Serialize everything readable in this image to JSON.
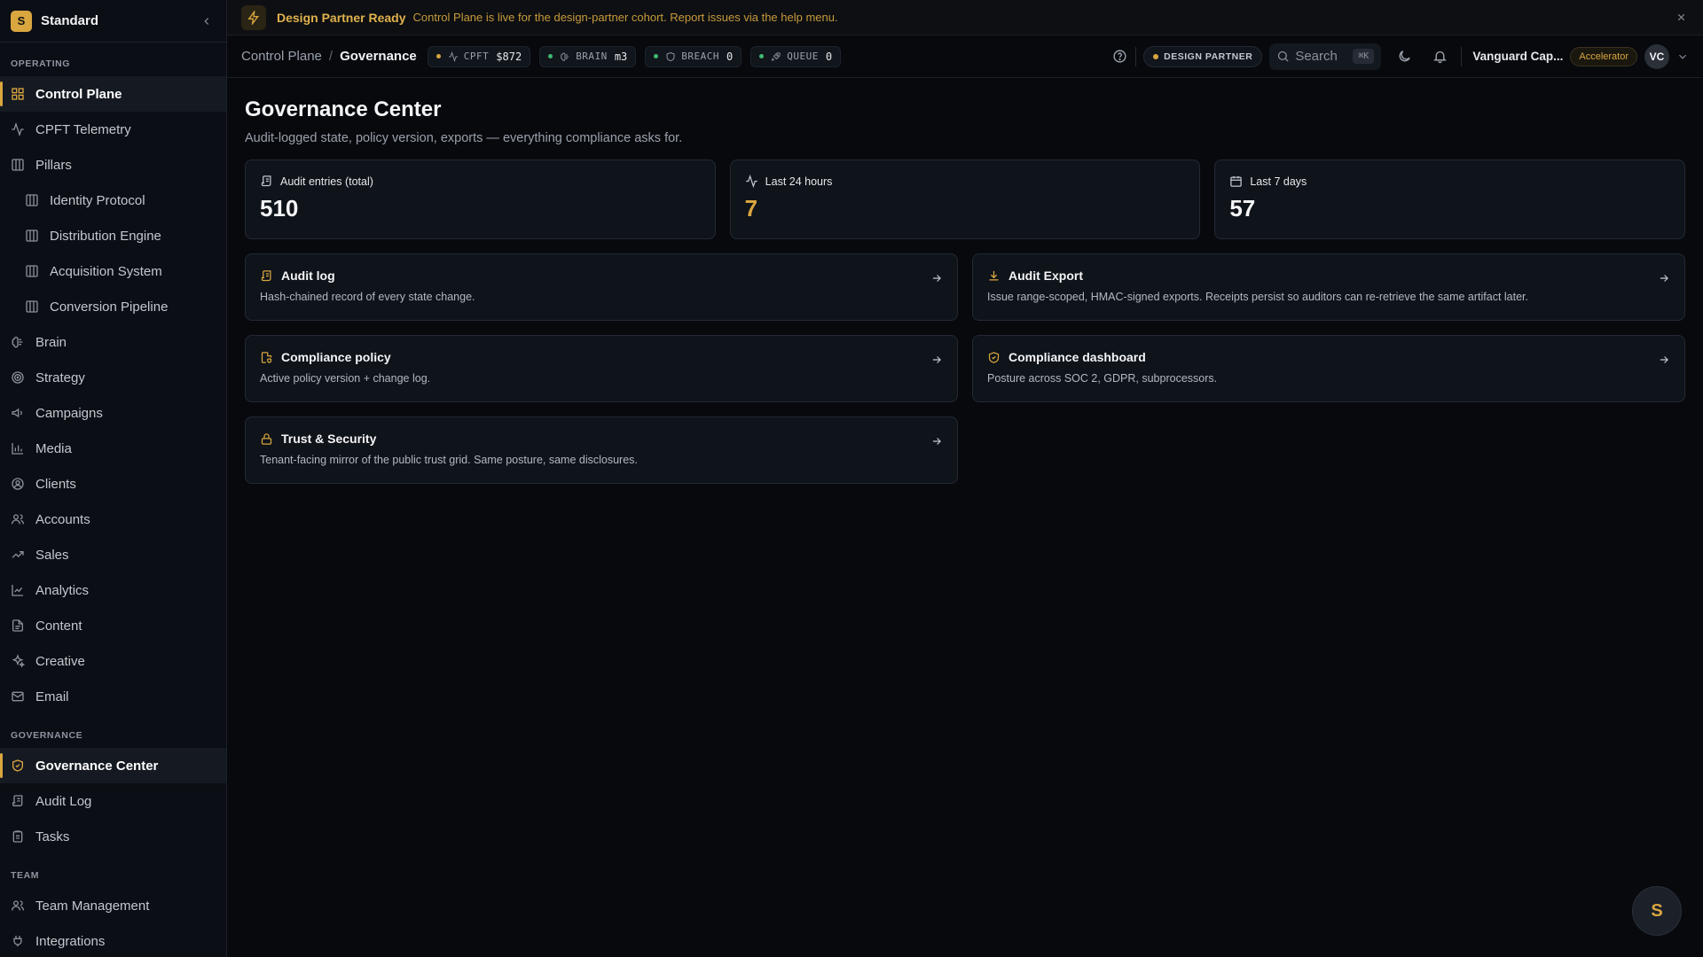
{
  "sidebar": {
    "brand": "Standard",
    "logo_letter": "S",
    "sections": {
      "operating": "OPERATING",
      "governance": "GOVERNANCE",
      "team": "TEAM"
    },
    "items": {
      "control_plane": "Control Plane",
      "cpft_telemetry": "CPFT Telemetry",
      "pillars": "Pillars",
      "identity_protocol": "Identity Protocol",
      "distribution_engine": "Distribution Engine",
      "acquisition_system": "Acquisition System",
      "conversion_pipeline": "Conversion Pipeline",
      "brain": "Brain",
      "strategy": "Strategy",
      "campaigns": "Campaigns",
      "media": "Media",
      "clients": "Clients",
      "accounts": "Accounts",
      "sales": "Sales",
      "analytics": "Analytics",
      "content": "Content",
      "creative": "Creative",
      "email": "Email",
      "governance_center": "Governance Center",
      "audit_log": "Audit Log",
      "tasks": "Tasks",
      "team_management": "Team Management",
      "integrations": "Integrations"
    }
  },
  "banner": {
    "title": "Design Partner Ready",
    "message": "Control Plane is live for the design-partner cohort. Report issues via the help menu."
  },
  "topbar": {
    "breadcrumb": [
      "Control Plane",
      "Governance"
    ],
    "separator": "/",
    "chips": [
      {
        "label": "CPFT",
        "value": "$872",
        "dot_color": "#d9a63f"
      },
      {
        "label": "BRAIN",
        "value": "m3",
        "dot_color": "#3fb970"
      },
      {
        "label": "BREACH",
        "value": "0",
        "dot_color": "#3fb970"
      },
      {
        "label": "QUEUE",
        "value": "0",
        "dot_color": "#3fb970"
      }
    ],
    "design_partner_badge": "DESIGN PARTNER",
    "search_placeholder": "Search",
    "search_shortcut": "⌘K",
    "user_name": "Vanguard Cap...",
    "plan_badge": "Accelerator",
    "avatar_initials": "VC"
  },
  "main": {
    "title": "Governance Center",
    "subtitle": "Audit-logged state, policy version, exports — everything compliance asks for.",
    "stats": [
      {
        "label": "Audit entries (total)",
        "value": "510",
        "icon": "ledger-icon"
      },
      {
        "label": "Last 24 hours",
        "value": "7",
        "icon": "activity-icon"
      },
      {
        "label": "Last 7 days",
        "value": "57",
        "icon": "calendar-icon"
      }
    ],
    "cards": [
      {
        "title": "Audit log",
        "desc": "Hash-chained record of every state change.",
        "icon": "ledger-icon"
      },
      {
        "title": "Audit Export",
        "desc": "Issue range-scoped, HMAC-signed exports. Receipts persist so auditors can re-retrieve the same artifact later.",
        "icon": "download-icon"
      },
      {
        "title": "Compliance policy",
        "desc": "Active policy version + change log.",
        "icon": "file-policy-icon"
      },
      {
        "title": "Compliance dashboard",
        "desc": "Posture across SOC 2, GDPR, subprocessors.",
        "icon": "shield-check-icon"
      },
      {
        "title": "Trust & Security",
        "desc": "Tenant-facing mirror of the public trust grid. Same posture, same disclosures.",
        "icon": "lock-icon"
      }
    ]
  },
  "fab": {
    "letter": "S"
  },
  "colors": {
    "accent": "#d9a63f",
    "background": "#07090d",
    "panel": "#0f131a",
    "status_ok": "#3fb970"
  }
}
